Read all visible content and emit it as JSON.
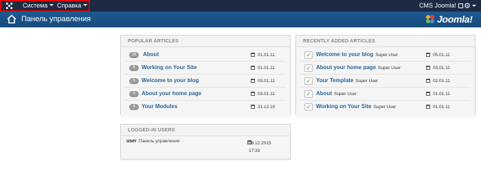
{
  "topbar": {
    "menu": [
      {
        "label": "Система"
      },
      {
        "label": "Справка"
      }
    ],
    "site_link": "CMS Joomla!",
    "icons": {
      "logo": "joomla-logo-icon",
      "external": "external-link-icon",
      "settings": "gear-icon"
    }
  },
  "header": {
    "title": "Панель управления",
    "brand": "Joomla!",
    "icons": {
      "home": "home-icon"
    }
  },
  "popular": {
    "title": "POPULAR ARTICLES",
    "items": [
      {
        "hits": "16",
        "title": "About",
        "date": "01.01.11"
      },
      {
        "hits": "6",
        "title": "Working on Your Site",
        "date": "01.01.11"
      },
      {
        "hits": "5",
        "title": "Welcome to your blog",
        "date": "05.01.11"
      },
      {
        "hits": "5",
        "title": "About your home page",
        "date": "03.01.11"
      },
      {
        "hits": "4",
        "title": "Your Modules",
        "date": "31.12.10"
      }
    ]
  },
  "recent": {
    "title": "RECENTLY ADDED ARTICLES",
    "items": [
      {
        "title": "Welcome to your blog",
        "author": "Super User",
        "date": "05.01.11"
      },
      {
        "title": "About your home page",
        "author": "Super User",
        "date": "03.01.11"
      },
      {
        "title": "Your Template",
        "author": "Super User",
        "date": "02.01.11"
      },
      {
        "title": "About",
        "author": "Super User",
        "date": "01.01.11"
      },
      {
        "title": "Working on Your Site",
        "author": "Super User",
        "date": "01.01.11"
      }
    ]
  },
  "logged": {
    "title": "LOGGED-IN USERS",
    "items": [
      {
        "name": "user",
        "location": "Панель управления",
        "date": "08.12.2015",
        "time": "17:33"
      }
    ]
  },
  "colors": {
    "topbar": "#1c2a44",
    "header": "#1f5a93",
    "link": "#2a6496",
    "highlight": "#e00000"
  }
}
